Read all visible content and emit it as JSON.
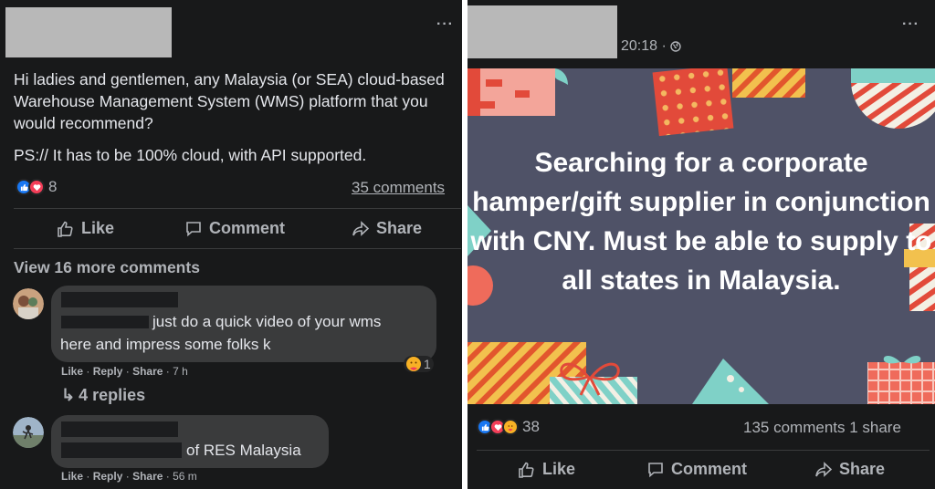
{
  "left_post": {
    "body": "Hi ladies and gentlemen, any Malaysia (or SEA) cloud-based Warehouse Management System (WMS) platform that you would recommend?",
    "ps": "PS:// It has to be 100% cloud, with API supported.",
    "reaction_count": "8",
    "comments_link": "35 comments",
    "actions": {
      "like": "Like",
      "comment": "Comment",
      "share": "Share"
    },
    "view_more": "View 16 more comments",
    "comments": [
      {
        "text_line1": "just do a quick video of your wms",
        "text_line2": "here and impress some folks k",
        "like": "Like",
        "reply": "Reply",
        "share": "Share",
        "time": "7 h",
        "reaction_count": "1",
        "replies": "4 replies"
      },
      {
        "text_suffix": "of RES Malaysia",
        "like": "Like",
        "reply": "Reply",
        "share": "Share",
        "time": "56 m"
      }
    ]
  },
  "right_post": {
    "timestamp": "20:18 ·",
    "image_caption": "Searching for a corporate hamper/gift supplier in conjunction with CNY. Must be able to supply to all states in Malaysia.",
    "reaction_count": "38",
    "comments_shares": "135 comments 1 share",
    "actions": {
      "like": "Like",
      "comment": "Comment",
      "share": "Share"
    }
  },
  "colors": {
    "background": "#18191a",
    "bubble": "#3a3b3c",
    "secondary_text": "#b0b3b8",
    "primary_text": "#e4e6eb",
    "like_blue": "#1877f2",
    "love_red": "#f33e58",
    "image_bg": "#4f5267"
  }
}
